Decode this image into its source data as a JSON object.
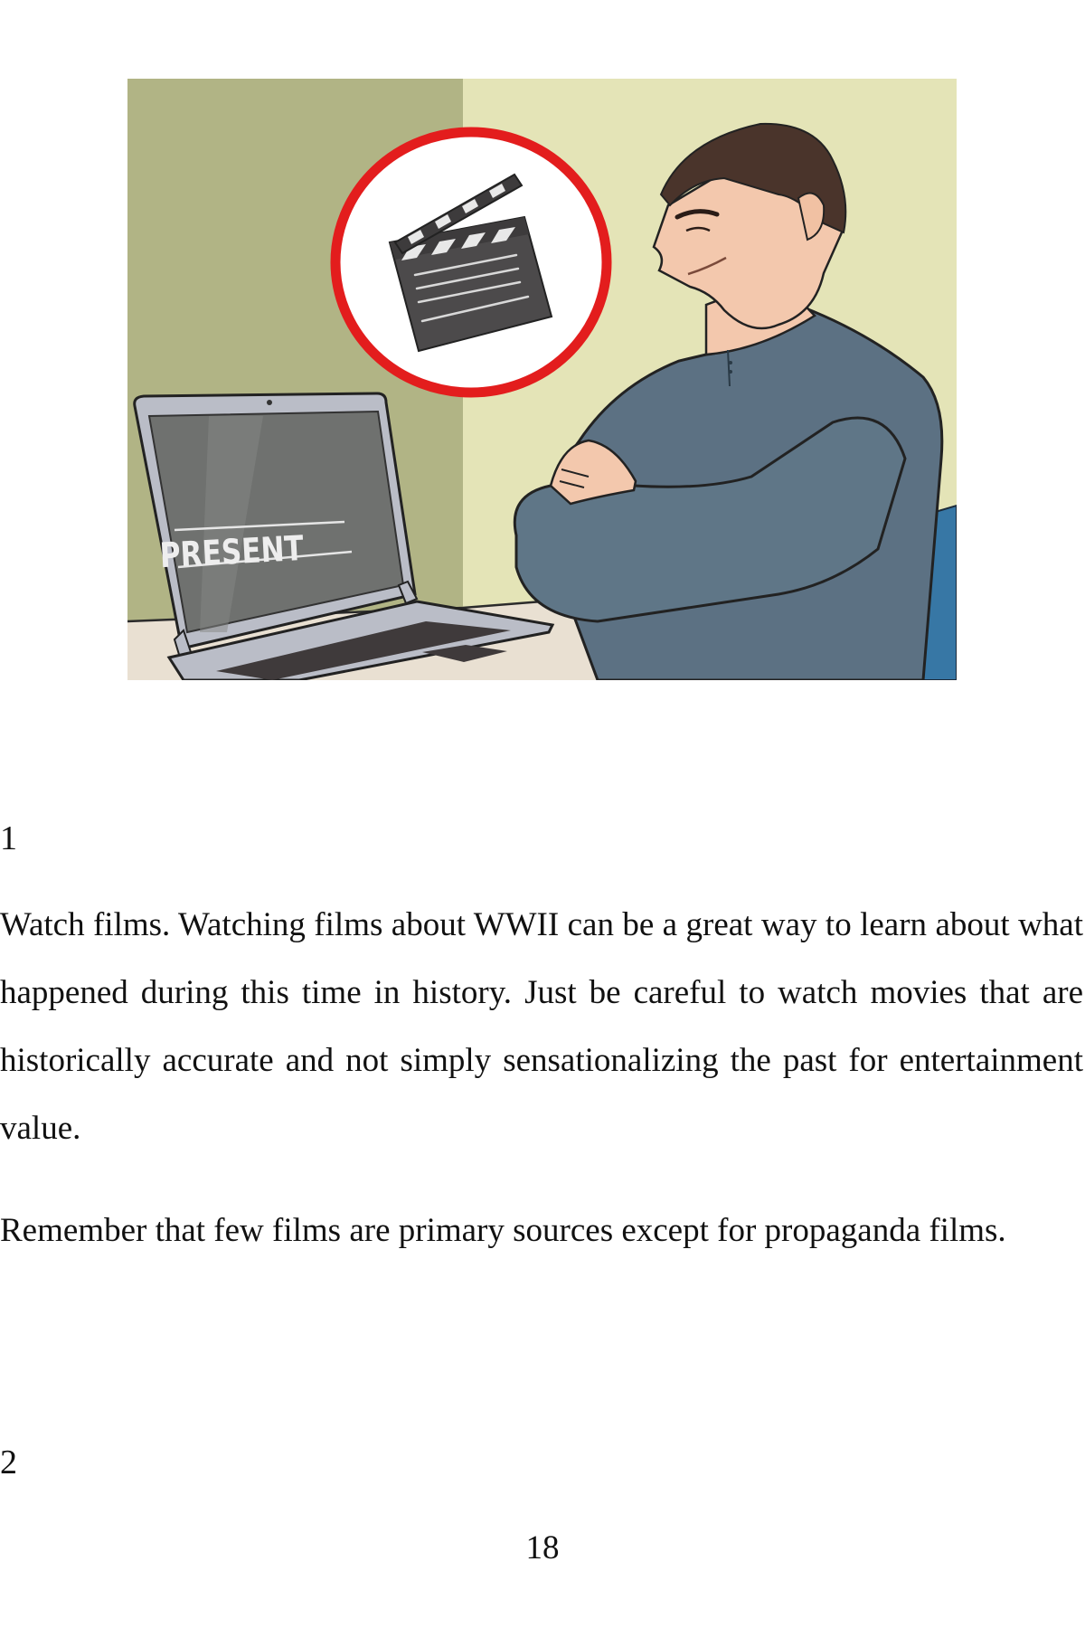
{
  "illustration": {
    "description": "Man with crossed arms looking at a laptop, thought bubble with film clapperboard",
    "laptop_screen_text": "PRESENT",
    "icon": "clapperboard-icon",
    "colors": {
      "wall_left": "#b1b485",
      "wall_right": "#e4e4b7",
      "desk": "#e9e0d2",
      "shirt": "#5c7183",
      "hair": "#4a342b",
      "skin": "#f3c8ad",
      "laptop_body": "#babdc7",
      "laptop_screen": "#6f716f",
      "ring_red": "#e31d1d",
      "chair_blue": "#3777a5"
    }
  },
  "steps": [
    {
      "number": "1",
      "paragraphs": [
        "Watch films. Watching films about WWII can be a great way to learn about what happened during this time in history. Just be careful to watch movies that are historically accurate and not simply sensationalizing the past for entertainment value.",
        "Remember that few films are primary sources except for propaganda films."
      ]
    },
    {
      "number": "2",
      "paragraphs": []
    }
  ],
  "page_number": "18"
}
